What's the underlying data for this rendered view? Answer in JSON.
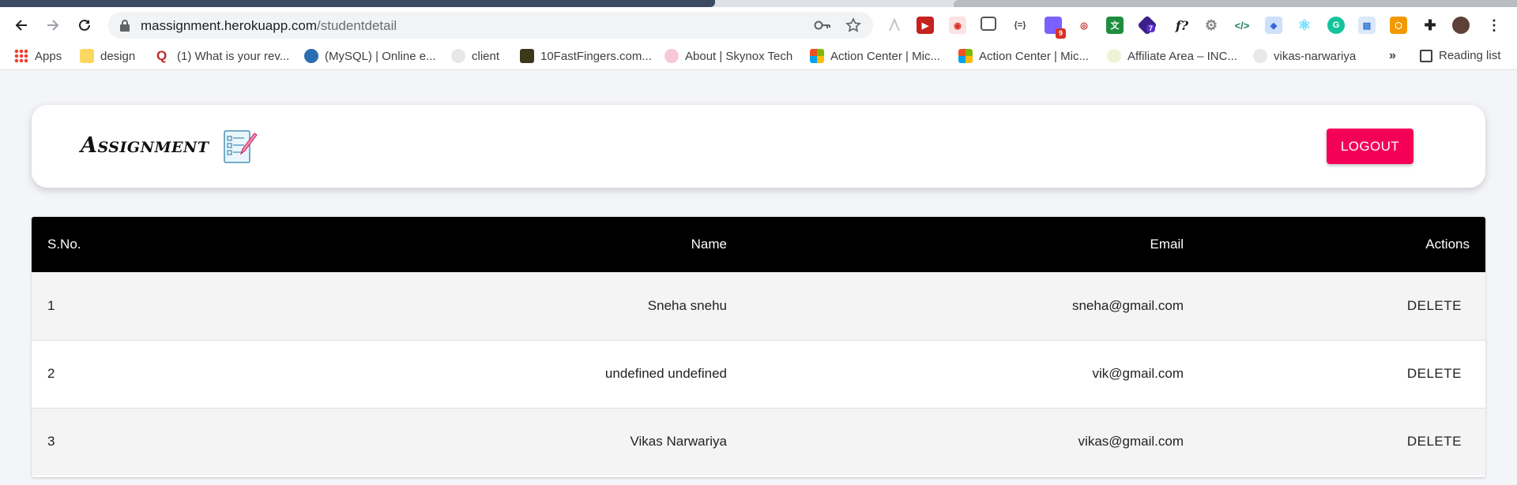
{
  "browser": {
    "url_host": "massignment.herokuapp.com",
    "url_path": "/studentdetail",
    "extension_badges": [
      "9",
      "7"
    ],
    "ext_fx_label": "f?",
    "ext_braces_label": "{=}",
    "more_label": "»",
    "reading_list": "Reading list",
    "bookmarks": [
      {
        "label": "Apps",
        "icon": "apps-grid-icon"
      },
      {
        "label": "design",
        "icon": "folder-icon"
      },
      {
        "label": "(1) What is your rev...",
        "icon": "quora-icon"
      },
      {
        "label": "(MySQL) | Online e...",
        "icon": "mysql-icon"
      },
      {
        "label": "client",
        "icon": "github-icon"
      },
      {
        "label": "10FastFingers.com...",
        "icon": "fastfingers-icon"
      },
      {
        "label": "About | Skynox Tech",
        "icon": "skynox-icon"
      },
      {
        "label": "Action Center | Mic...",
        "icon": "microsoft-icon"
      },
      {
        "label": "Action Center | Mic...",
        "icon": "microsoft-icon"
      },
      {
        "label": "Affiliate Area – INC...",
        "icon": "affiliate-icon"
      },
      {
        "label": "vikas-narwariya",
        "icon": "github-icon"
      }
    ]
  },
  "header": {
    "logo_text": "Assignment",
    "logout_label": "LOGOUT"
  },
  "table": {
    "columns": [
      "S.No.",
      "Name",
      "Email",
      "Actions"
    ],
    "rows": [
      {
        "sno": "1",
        "name": "Sneha snehu",
        "email": "sneha@gmail.com",
        "action": "DELETE"
      },
      {
        "sno": "2",
        "name": "undefined undefined",
        "email": "vik@gmail.com",
        "action": "DELETE"
      },
      {
        "sno": "3",
        "name": "Vikas Narwariya",
        "email": "vikas@gmail.com",
        "action": "DELETE"
      }
    ]
  },
  "colors": {
    "accent": "#f50057",
    "table_header": "#000000"
  }
}
